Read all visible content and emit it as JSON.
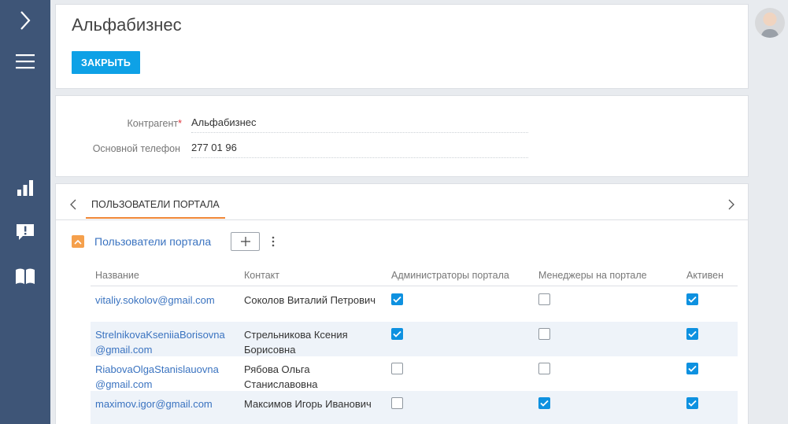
{
  "header": {
    "title": "Альфабизнес",
    "close_label": "ЗАКРЫТЬ"
  },
  "fields": {
    "account_label": "Контрагент",
    "account_required_mark": "*",
    "account_value": "Альфабизнес",
    "phone_label": "Основной телефон",
    "phone_value": "277 01 96"
  },
  "tabs": {
    "active_tab": "ПОЛЬЗОВАТЕЛИ ПОРТАЛА"
  },
  "detail": {
    "title": "Пользователи портала",
    "columns": [
      "Название",
      "Контакт",
      "Администраторы портала",
      "Менеджеры на портале",
      "Активен"
    ],
    "rows": [
      {
        "name": "vitaliy.sokolov@gmail.com",
        "contact": "Соколов Виталий Петрович",
        "admin": true,
        "manager": false,
        "active": true
      },
      {
        "name": "StrelnikovaKseniiaBorisovna@gmail.com",
        "contact": "Стрельникова Ксения Борисовна",
        "admin": true,
        "manager": false,
        "active": true
      },
      {
        "name": "RiabovaOlgaStanislauovna@gmail.com",
        "contact": "Рябова Ольга Станиславовна",
        "admin": false,
        "manager": false,
        "active": true
      },
      {
        "name": "maximov.igor@gmail.com",
        "contact": "Максимов Игорь Иванович",
        "admin": false,
        "manager": true,
        "active": true
      }
    ]
  },
  "colors": {
    "nav_bg": "#3e5577",
    "primary_button": "#0ea1e6",
    "link": "#3a73c0",
    "tab_accent": "#f08736",
    "checkbox_on": "#0e91e0"
  }
}
